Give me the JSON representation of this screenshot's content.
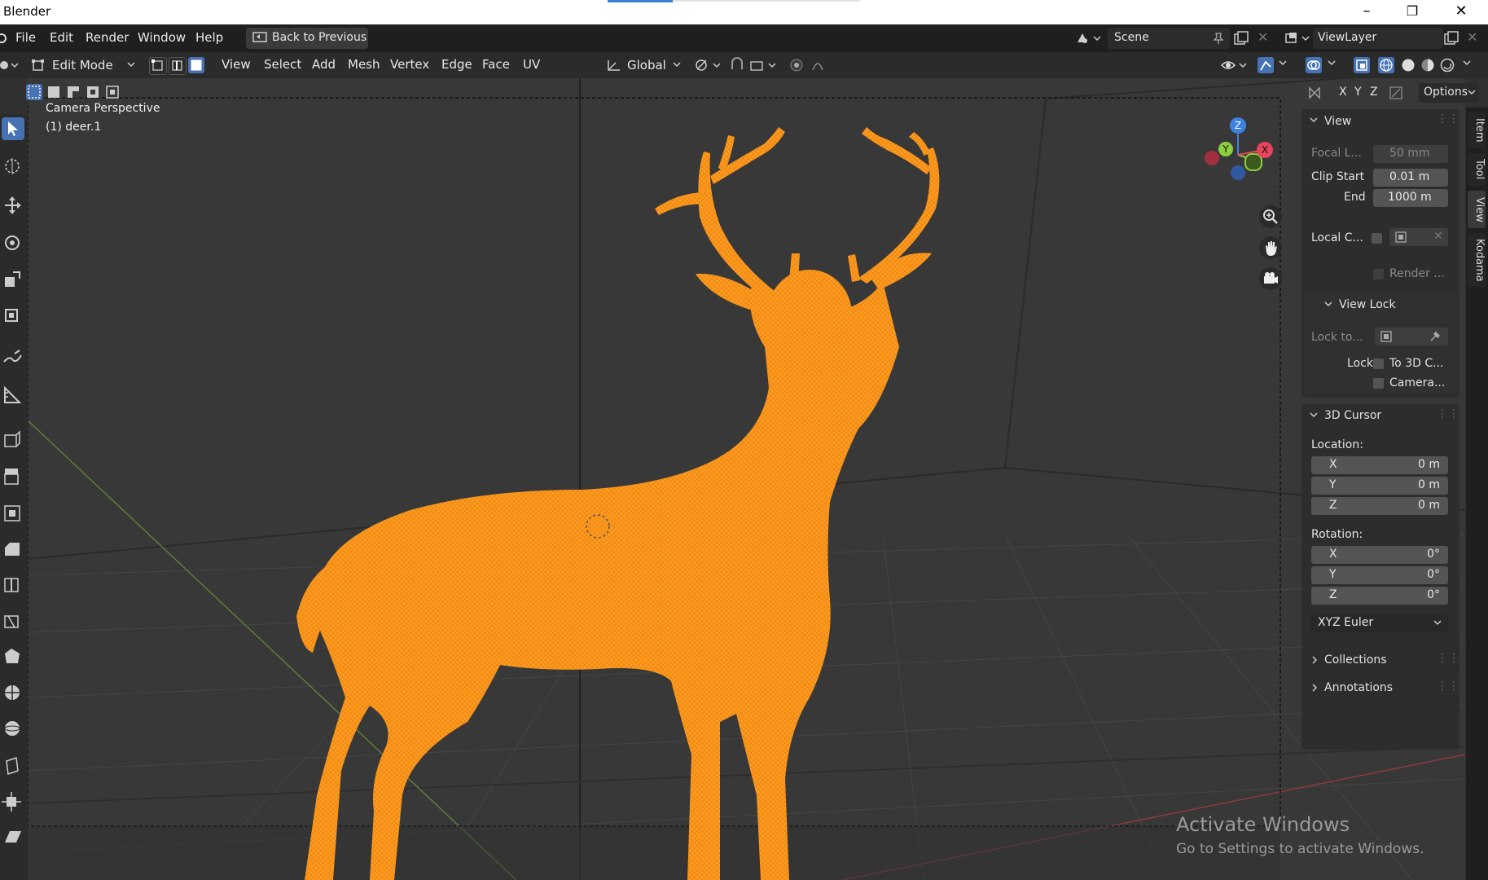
{
  "window": {
    "title": "Blender",
    "minimize_glyph": "–",
    "maximize_glyph": "❐",
    "close_glyph": "✕"
  },
  "menubar": {
    "items": [
      "File",
      "Edit",
      "Render",
      "Window",
      "Help"
    ],
    "back_label": "Back to Previous",
    "scene_label": "Scene",
    "viewlayer_label": "ViewLayer"
  },
  "header": {
    "mode": "Edit Mode",
    "menus": [
      "View",
      "Select",
      "Add",
      "Mesh",
      "Vertex",
      "Edge",
      "Face",
      "UV"
    ],
    "orientation": "Global",
    "axis_x": "X",
    "axis_y": "Y",
    "axis_z": "Z",
    "options_label": "Options"
  },
  "viewport": {
    "perspective": "Camera Perspective",
    "object": "(1) deer.1",
    "gizmo": {
      "z": "Z",
      "y": "Y",
      "x": "X"
    },
    "mesh_color": "#ff9a1e"
  },
  "sidebar": {
    "view": {
      "title": "View",
      "focal_label": "Focal L...",
      "focal_value": "50 mm",
      "clip_start_label": "Clip Start",
      "clip_start_value": "0.01 m",
      "end_label": "End",
      "end_value": "1000 m",
      "local_camera_label": "Local C...",
      "render_label": "Render ...",
      "view_lock_title": "View Lock",
      "lock_to_label": "Lock to...",
      "lock_label": "Lock",
      "to_3d_cursor": "To 3D C...",
      "camera_label": "Camera..."
    },
    "cursor": {
      "title": "3D Cursor",
      "location_label": "Location:",
      "loc": [
        {
          "axis": "X",
          "value": "0 m"
        },
        {
          "axis": "Y",
          "value": "0 m"
        },
        {
          "axis": "Z",
          "value": "0 m"
        }
      ],
      "rotation_label": "Rotation:",
      "rot": [
        {
          "axis": "X",
          "value": "0°"
        },
        {
          "axis": "Y",
          "value": "0°"
        },
        {
          "axis": "Z",
          "value": "0°"
        }
      ],
      "rotation_mode": "XYZ Euler"
    },
    "collections_title": "Collections",
    "annotations_title": "Annotations",
    "tabs": [
      "Item",
      "Tool",
      "View",
      "Kodama"
    ]
  },
  "watermark": {
    "line1": "Activate Windows",
    "line2": "Go to Settings to activate Windows."
  },
  "colors": {
    "accent": "#4772b3",
    "active_tool": "#4772b3",
    "gizmo_x": "#e8435a",
    "gizmo_y": "#8ccf3e",
    "gizmo_z": "#3e82e0"
  }
}
